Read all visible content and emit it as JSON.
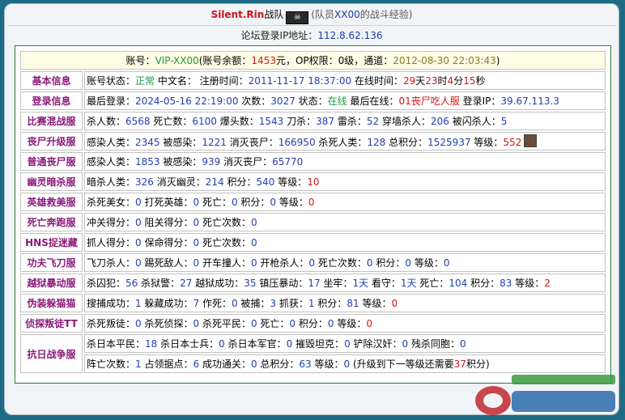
{
  "title": {
    "name": "Silent.Rin",
    "suffix": "战队",
    "member_prefix": "(队员",
    "member_code": "XX00",
    "member_suffix": "的战斗经验)"
  },
  "ip_line": {
    "label": "论坛登录IP地址：",
    "value": "112.8.62.136"
  },
  "head": {
    "a": "账号：",
    "acct": "VIP-XX00",
    "b": "(账号余额：",
    "bal": "1453",
    "c": "元，OP权限：",
    "op": "0级",
    "d": "，通道：",
    "chan": "2012-08-30 22:03:43",
    "e": ")"
  },
  "rows": {
    "basic": {
      "label": "基本信息",
      "p1": "账号状态：",
      "status": "正常",
      "p2": " 中文名： 注册时间：",
      "reg": "2011-11-17 18:37:00",
      "p3": " 在线时间：",
      "d": "29",
      "du": "天",
      "h": "23",
      "hu": "时",
      "m": "4",
      "mu": "分",
      "s": "15",
      "su": "秒"
    },
    "login": {
      "label": "登录信息",
      "p1": "最后登录：",
      "last": "2024-05-16 22:19:00",
      "p2": " 次数：",
      "count": "3027",
      "p3": " 状态：",
      "state": "在线",
      "p4": " 最后在线：",
      "where": "01丧尸吃人服",
      "p5": " 登录IP：",
      "ip": "39.67.113.3"
    },
    "r3": {
      "label": "比赛混战服",
      "parts": [
        [
          "杀人数：",
          "6568"
        ],
        [
          " 死亡数：",
          "6100"
        ],
        [
          " 爆头数：",
          "1543"
        ],
        [
          " 刀杀：",
          "387"
        ],
        [
          " 雷杀：",
          "52"
        ],
        [
          " 穿墙杀人：",
          "206"
        ],
        [
          " 被闪杀人：",
          "5"
        ]
      ]
    },
    "r4": {
      "label": "丧尸升级服",
      "parts": [
        [
          "感染人类：",
          "2345"
        ],
        [
          " 被感染：",
          "1221"
        ],
        [
          " 消灭丧尸：",
          "166950"
        ],
        [
          " 杀死人类：",
          "128"
        ],
        [
          " 总积分：",
          "1525937"
        ],
        [
          " 等级：",
          ""
        ]
      ],
      "level": "552"
    },
    "r5": {
      "label": "普通丧尸服",
      "parts": [
        [
          "感染人类：",
          "1853"
        ],
        [
          " 被感染：",
          "939"
        ],
        [
          " 消灭丧尸：",
          "65770"
        ]
      ]
    },
    "r6": {
      "label": "幽灵暗杀服",
      "parts": [
        [
          "暗杀人类：",
          "326"
        ],
        [
          " 消灭幽灵：",
          "214"
        ],
        [
          " 积分：",
          "540"
        ],
        [
          " 等级：",
          ""
        ]
      ],
      "level": "10"
    },
    "r7": {
      "label": "英雄救美服",
      "parts": [
        [
          "杀死美女：",
          "0"
        ],
        [
          " 打死英雄：",
          "0"
        ],
        [
          " 死亡：",
          "0"
        ],
        [
          " 积分：",
          "0"
        ],
        [
          " 等级：",
          ""
        ]
      ],
      "level": "0"
    },
    "r8": {
      "label": "死亡奔跑服",
      "parts": [
        [
          "冲关得分：",
          "0"
        ],
        [
          " 阻关得分：",
          "0"
        ],
        [
          " 死亡次数：",
          "0"
        ]
      ]
    },
    "r9": {
      "label": "HNS捉迷藏",
      "parts": [
        [
          "抓人得分：",
          "0"
        ],
        [
          " 保命得分：",
          "0"
        ],
        [
          " 死亡次数：",
          "0"
        ]
      ]
    },
    "r10": {
      "label": "功夫飞刀服",
      "parts": [
        [
          "飞刀杀人：",
          "0"
        ],
        [
          " 踢死敌人：",
          "0"
        ],
        [
          " 开车撞人：",
          "0"
        ],
        [
          " 开枪杀人：",
          "0"
        ],
        [
          " 死亡次数：",
          "0"
        ],
        [
          " 积分：",
          "0"
        ],
        [
          " 等级：",
          "0"
        ]
      ]
    },
    "r11": {
      "label": "越狱暴动服",
      "parts": [
        [
          "杀囚犯：",
          "56"
        ],
        [
          " 杀狱警：",
          "27"
        ],
        [
          " 越狱成功：",
          "35"
        ],
        [
          " 镇压暴动：",
          "17"
        ],
        [
          " 坐牢：",
          "1天"
        ],
        [
          " 看守：",
          "1天"
        ],
        [
          " 死亡：",
          "104"
        ],
        [
          " 积分：",
          "83"
        ],
        [
          " 等级：",
          ""
        ]
      ],
      "level": "2"
    },
    "r12": {
      "label": "伪装躲猫猫",
      "parts": [
        [
          "搜捕成功：",
          "1"
        ],
        [
          " 躲藏成功：",
          "7"
        ],
        [
          " 作死：",
          "0"
        ],
        [
          " 被捕：",
          "3"
        ],
        [
          " 抓获：",
          "1"
        ],
        [
          " 积分：",
          "81"
        ],
        [
          " 等级：",
          ""
        ]
      ],
      "level": "0"
    },
    "r13": {
      "label": "侦探叛徒TT",
      "parts": [
        [
          "杀死叛徒：",
          "0"
        ],
        [
          " 杀死侦探：",
          "0"
        ],
        [
          " 杀死平民：",
          "0"
        ],
        [
          " 死亡：",
          "0"
        ],
        [
          " 积分：",
          "0"
        ],
        [
          " 等级：",
          ""
        ]
      ],
      "level": "0"
    },
    "r14": {
      "label": "抗日战争服",
      "l1": [
        [
          "杀日本平民：",
          "18"
        ],
        [
          " 杀日本士兵：",
          "0"
        ],
        [
          " 杀日本军官：",
          "0"
        ],
        [
          " 摧毁坦克：",
          "0"
        ],
        [
          " 铲除汉奸：",
          "0"
        ],
        [
          " 残杀同胞：",
          "0"
        ]
      ],
      "l2": [
        [
          "阵亡次数：",
          "1"
        ],
        [
          " 占领据点：",
          "6"
        ],
        [
          " 成功通关：",
          "0"
        ],
        [
          " 总积分：",
          "63"
        ],
        [
          " 等级：",
          "0"
        ]
      ],
      "l2_tail_a": " (升级到下一等级还需要",
      "l2_need": "37",
      "l2_tail_b": "积分)"
    }
  },
  "colors": {
    "accent": "#8b1a7b",
    "value": "#2240b0",
    "red": "#d31515",
    "green": "#1a9a3a"
  }
}
